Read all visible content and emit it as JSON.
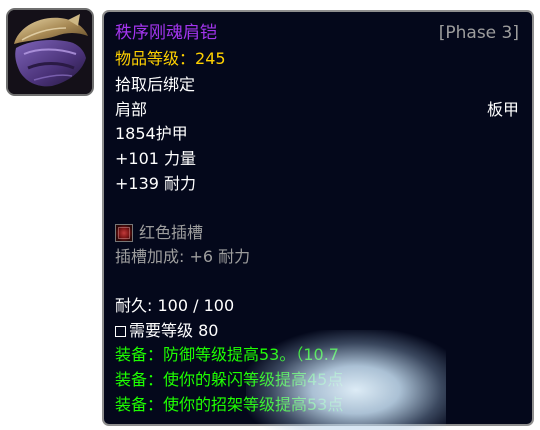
{
  "item": {
    "name": "秩序刚魂肩铠",
    "phase": "[Phase 3]",
    "item_level_label": "物品等级：",
    "item_level_value": "245",
    "binding": "拾取后绑定",
    "slot": "肩部",
    "armor_type": "板甲",
    "armor": "1854护甲",
    "stats": [
      "+101 力量",
      "+139 耐力"
    ],
    "socket": {
      "icon": "red-socket-icon",
      "label": "红色插槽",
      "bonus": "插槽加成: +6 耐力"
    },
    "durability": "耐久: 100 / 100",
    "required_level": "需要等级 80",
    "equip_effects": [
      "装备：防御等级提高53。（10.7",
      "装备：使你的躲闪等级提高45点",
      "装备：使你的招架等级提高53点"
    ]
  },
  "colors": {
    "epic_name": "#a335ee",
    "item_level": "#ffd100",
    "socket_text": "#9d9d9d",
    "equip_effect": "#1eff00",
    "tooltip_background": "#04081b"
  },
  "icons": {
    "item_icon": "shoulder-armor-icon",
    "required_level_box": "checkbox-icon"
  }
}
